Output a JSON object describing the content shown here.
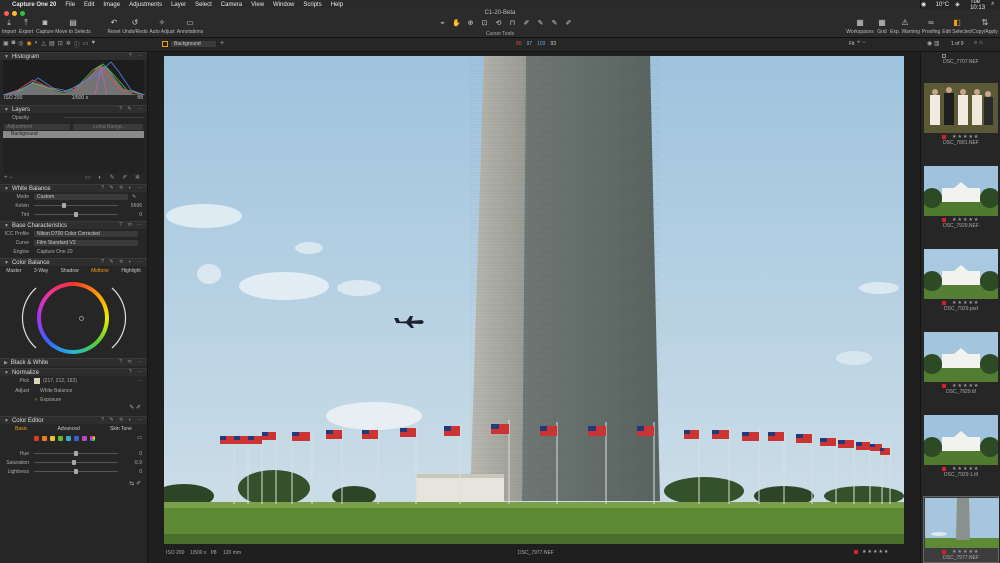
{
  "menubar": {
    "app": "Capture One 20",
    "items": [
      "File",
      "Edit",
      "Image",
      "Adjustments",
      "Layer",
      "Select",
      "Camera",
      "View",
      "Window",
      "Scripts",
      "Help"
    ],
    "status": [
      "10°C",
      "Tue 10:13"
    ]
  },
  "window": {
    "title": "C1-20-Beta"
  },
  "toolbar": {
    "left": [
      "Import",
      "Export",
      "Capture",
      "Move to Selects"
    ],
    "mid": [
      "Reset",
      "Undo/Redo",
      "Auto Adjust",
      "Annotations"
    ],
    "right": [
      "Workspaces",
      "Grid",
      "Exp. Warning",
      "Proofing",
      "Edit Selected",
      "Copy/Apply"
    ],
    "cursor_tools_label": "Cursor Tools"
  },
  "secbar": {
    "layer": "Background",
    "values": [
      "80",
      "97",
      "103",
      "93"
    ],
    "fit": "Fit",
    "count": "1 of 9"
  },
  "histogram": {
    "title": "Histogram",
    "iso": "ISO 200",
    "shutter": "1/500 s",
    "aperture": "f/8"
  },
  "layers": {
    "title": "Layers",
    "opacity": "Opacity",
    "adjustment": "Adjustment",
    "luma": "Luma Range...",
    "background": "Background"
  },
  "white_balance": {
    "title": "White Balance",
    "mode_label": "Mode",
    "mode": "Custom",
    "kelvin_label": "Kelvin",
    "kelvin": "5696",
    "tint_label": "Tint",
    "tint": "0"
  },
  "base": {
    "title": "Base Characteristics",
    "icc_label": "ICC Profile",
    "icc": "Nikon D700 Color Corrected",
    "curve_label": "Curve",
    "curve": "Film Standard V2",
    "engine_label": "Engine",
    "engine": "Capture One 20"
  },
  "color_balance": {
    "title": "Color Balance",
    "tabs": [
      "Master",
      "3-Way",
      "Shadow",
      "Midtone",
      "Highlight"
    ]
  },
  "bw": {
    "title": "Black & White"
  },
  "normalize": {
    "title": "Normalize",
    "pick_label": "Pick",
    "pick": "(217, 212, 192)",
    "adjust_label": "Adjust",
    "adjust": "White Balance",
    "exposure": "Exposure"
  },
  "color_editor": {
    "title": "Color Editor",
    "tabs": [
      "Basic",
      "Advanced",
      "Skin Tone"
    ],
    "hue_label": "Hue",
    "hue": "0",
    "sat_label": "Saturation",
    "sat": "-5.9",
    "light_label": "Lightness",
    "light": "0",
    "swatches": [
      "#d8392b",
      "#e67e22",
      "#e4c42a",
      "#5fb83a",
      "#3aa9c8",
      "#3c5fd0",
      "#b24bb3"
    ]
  },
  "viewer": {
    "iso": "ISO 200",
    "shutter": "1/500 s",
    "aperture": "f/8",
    "focal": "120 mm",
    "filename": "DSC_7977.NEF"
  },
  "filmstrip": [
    {
      "name": "DSC_7707.NEF"
    },
    {
      "name": "DSC_7881.NEF"
    },
    {
      "name": "DSC_7929.NEF"
    },
    {
      "name": "DSC_7929.psd"
    },
    {
      "name": "DSC_7929.tif"
    },
    {
      "name": "DSC_7929 1.tif"
    },
    {
      "name": "DSC_7977.NEF"
    }
  ]
}
